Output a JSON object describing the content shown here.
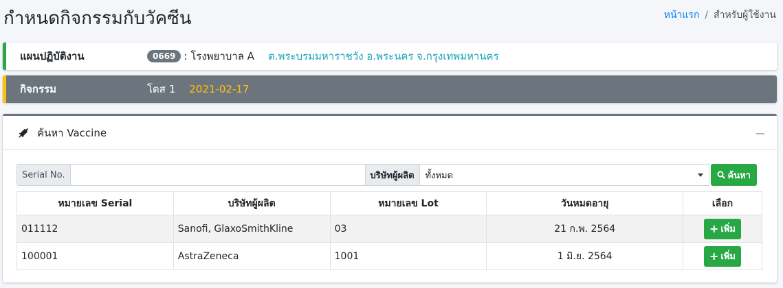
{
  "header": {
    "title": "กำหนดกิจกรรมกับวัคซีน",
    "breadcrumb_home": "หน้าแรก",
    "breadcrumb_sep": "/",
    "breadcrumb_current": "สำหรับผู้ใช้งาน"
  },
  "plan": {
    "label": "แผนปฏิบัติงาน",
    "code": "0669",
    "hospital": ": โรงพยาบาล A",
    "location": "ต.พระบรมมหาราชวัง อ.พระนคร จ.กรุงเทพมหานคร",
    "accent": "#28a745"
  },
  "activity": {
    "label": "กิจกรรม",
    "dose": "โดส 1",
    "date": "2021-02-17",
    "accent": "#ffc107"
  },
  "search_card": {
    "title": "ค้นหา Vaccine",
    "icon": "syringe-icon",
    "serial_label": "Serial No.",
    "serial_value": "",
    "company_label": "บริษัทผู้ผลิต",
    "company_selected": "ทั้งหมด",
    "search_button": "ค้นหา"
  },
  "table": {
    "headers": [
      "หมายเลข Serial",
      "บริษัทผู้ผลิต",
      "หมายเลข Lot",
      "วันหมดอายุ",
      "เลือก"
    ],
    "rows": [
      {
        "serial": "011112",
        "company": "Sanofi, GlaxoSmithKline",
        "lot": "03",
        "expiry": "21 ก.พ. 2564",
        "action": "เพิ่ม"
      },
      {
        "serial": "100001",
        "company": "AstraZeneca",
        "lot": "1001",
        "expiry": "1 มิ.ย. 2564",
        "action": "เพิ่ม"
      }
    ]
  }
}
